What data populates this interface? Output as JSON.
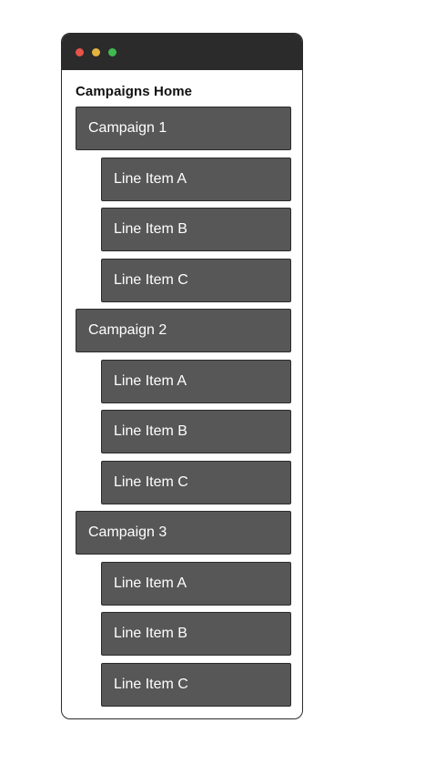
{
  "window": {
    "colors": {
      "close": "#e5534b",
      "minimize": "#e3b341",
      "zoom": "#3fb950",
      "titlebar": "#2b2b2b",
      "item_bg": "#575757"
    }
  },
  "page": {
    "title": "Campaigns Home"
  },
  "campaigns": [
    {
      "label": "Campaign 1",
      "line_items": [
        "Line Item A",
        "Line Item B",
        "Line Item C"
      ]
    },
    {
      "label": "Campaign 2",
      "line_items": [
        "Line Item A",
        "Line Item B",
        "Line Item C"
      ]
    },
    {
      "label": "Campaign 3",
      "line_items": [
        "Line Item A",
        "Line Item B",
        "Line Item C"
      ]
    }
  ]
}
